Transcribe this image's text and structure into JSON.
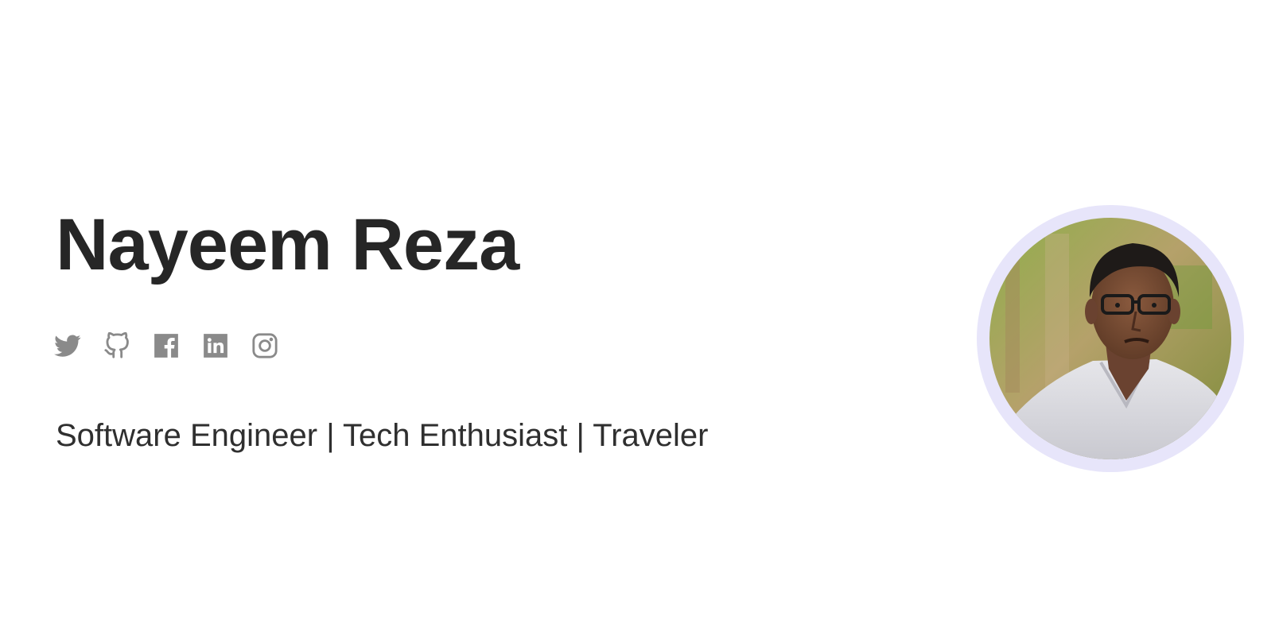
{
  "profile": {
    "name": "Nayeem Reza",
    "tagline": "Software Engineer | Tech Enthusiast | Traveler"
  },
  "social_links": [
    {
      "icon": "twitter-icon"
    },
    {
      "icon": "github-icon"
    },
    {
      "icon": "facebook-icon"
    },
    {
      "icon": "linkedin-icon"
    },
    {
      "icon": "instagram-icon"
    }
  ],
  "colors": {
    "background": "#ffffff",
    "heading": "#262626",
    "icon": "#8a8a8a",
    "avatar_ring": "#e7e5fa"
  }
}
